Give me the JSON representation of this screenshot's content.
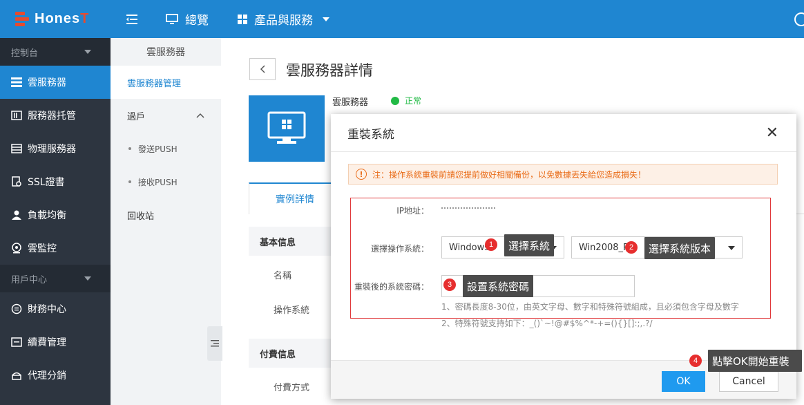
{
  "brand": {
    "logo_text_a": "Hones",
    "logo_text_b": "T"
  },
  "topbar": {
    "nav": [
      {
        "label": "總覽"
      },
      {
        "label": "產品與服務"
      }
    ]
  },
  "sidebar": {
    "section_console": "控制台",
    "items": [
      {
        "label": "雲服務器"
      },
      {
        "label": "服務器托管"
      },
      {
        "label": "物理服務器"
      },
      {
        "label": "SSL證書"
      },
      {
        "label": "負載均衡"
      },
      {
        "label": "雲監控"
      }
    ],
    "section_user": "用戶中心",
    "user_items": [
      {
        "label": "財務中心"
      },
      {
        "label": "續費管理"
      },
      {
        "label": "代理分銷"
      }
    ]
  },
  "subbar": {
    "title": "雲服務器",
    "items": [
      {
        "label": "雲服務器管理"
      },
      {
        "label": "過戶"
      },
      {
        "label": "發送PUSH"
      },
      {
        "label": "接收PUSH"
      },
      {
        "label": "回收站"
      }
    ]
  },
  "main": {
    "title": "雲服務器詳情",
    "server_label": "雲服務器",
    "status": "正常",
    "tab_active": "實例詳情",
    "section_basic": "基本信息",
    "row_name": "名稱",
    "row_os": "操作系統",
    "section_pay": "付費信息",
    "row_pay": "付費方式"
  },
  "modal": {
    "title": "重裝系統",
    "notice": "注：操作系統重裝前請您提前做好相關備份，以免數據丟失給您造成損失！",
    "ip_label": "IP地址：",
    "os_label": "選擇操作系統：",
    "os_value": "Windows",
    "version_value": "Win2008_R2",
    "pw_label": "重裝後的系統密碼：",
    "hint1": "1、密碼長度8-30位，由英文字母、數字和特殊符號組成，且必須包含字母及數字",
    "hint2": "2、特殊符號支持如下：_()`~!@#$%^*-+=(){}[]:;,.?/",
    "ok": "OK",
    "cancel": "Cancel"
  },
  "annotations": [
    {
      "num": "1",
      "text": "選擇系統"
    },
    {
      "num": "2",
      "text": "選擇系統版本"
    },
    {
      "num": "3",
      "text": "設置系統密碼"
    },
    {
      "num": "4",
      "text": "點擊OK開始重裝"
    }
  ],
  "colors": {
    "brand_blue": "#1f86d1",
    "sidebar_dark": "#2d3540",
    "ok_blue": "#1f9aef",
    "warning": "#e96b17",
    "status_green": "#21ba45",
    "annotation_red": "#e62e2e"
  }
}
